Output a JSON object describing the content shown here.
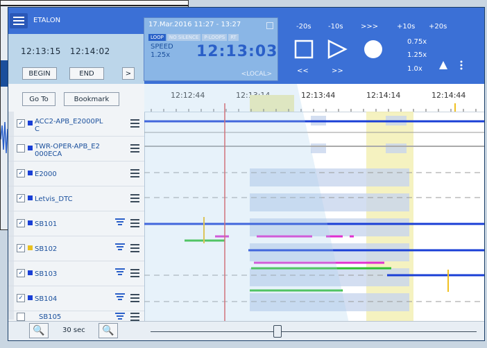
{
  "app": {
    "title": "ETALON"
  },
  "info": {
    "range": "17.Mar.2016 11:27 - 13:27",
    "tags": [
      {
        "label": "LOOP",
        "active": true
      },
      {
        "label": "NO SILENCE",
        "active": false
      },
      {
        "label": "P-LOOPS",
        "active": false
      },
      {
        "label": "RT",
        "active": false
      }
    ],
    "speed_label": "SPEED",
    "speed_value": "1.25x",
    "clock": "12:13:03",
    "source": "<LOCAL>"
  },
  "playback": {
    "jumps": [
      "-20s",
      "-10s",
      ">>>",
      "+10s",
      "+20s"
    ],
    "rates": [
      "0.75x",
      "1.25x",
      "1.0x"
    ],
    "rewind": "<<",
    "forward": ">>"
  },
  "controls": {
    "time_start": "12:13:15",
    "time_end": "12:14:02",
    "begin": "BEGIN",
    "end": "END",
    "next": ">",
    "goto": "Go To",
    "bookmark": "Bookmark",
    "zoom_interval": "30 sec"
  },
  "timeline": {
    "ticks": [
      "12:12:44",
      "12:13:14",
      "12:13:44",
      "12:14:14",
      "12:14:44"
    ]
  },
  "channels": [
    {
      "label": "ACC2-APB_E2000PLC",
      "color": "#1a3fd6",
      "checked": true,
      "filter": false
    },
    {
      "label": "TWR-OPER-APB_E2000ECA",
      "color": "#1a3fd6",
      "checked": false,
      "filter": false
    },
    {
      "label": "E2000",
      "color": "#1a3fd6",
      "checked": true,
      "filter": false
    },
    {
      "label": "Letvis_DTC",
      "color": "#1a3fd6",
      "checked": true,
      "filter": false
    },
    {
      "label": "SB101",
      "color": "#1a3fd6",
      "checked": true,
      "filter": true
    },
    {
      "label": "SB102",
      "color": "#e8c020",
      "checked": true,
      "filter": true
    },
    {
      "label": "SB103",
      "color": "#1a3fd6",
      "checked": true,
      "filter": true
    },
    {
      "label": "SB104",
      "color": "#1a3fd6",
      "checked": true,
      "filter": true
    },
    {
      "label": "SB105",
      "color": "#1a3fd6",
      "checked": false,
      "filter": true
    }
  ],
  "colors": {
    "accent": "#3b70d6",
    "cursor": "#e05050",
    "highlight": "#f3efb0",
    "magenta": "#e030d0",
    "green": "#30c030",
    "amber": "#f0c020"
  }
}
